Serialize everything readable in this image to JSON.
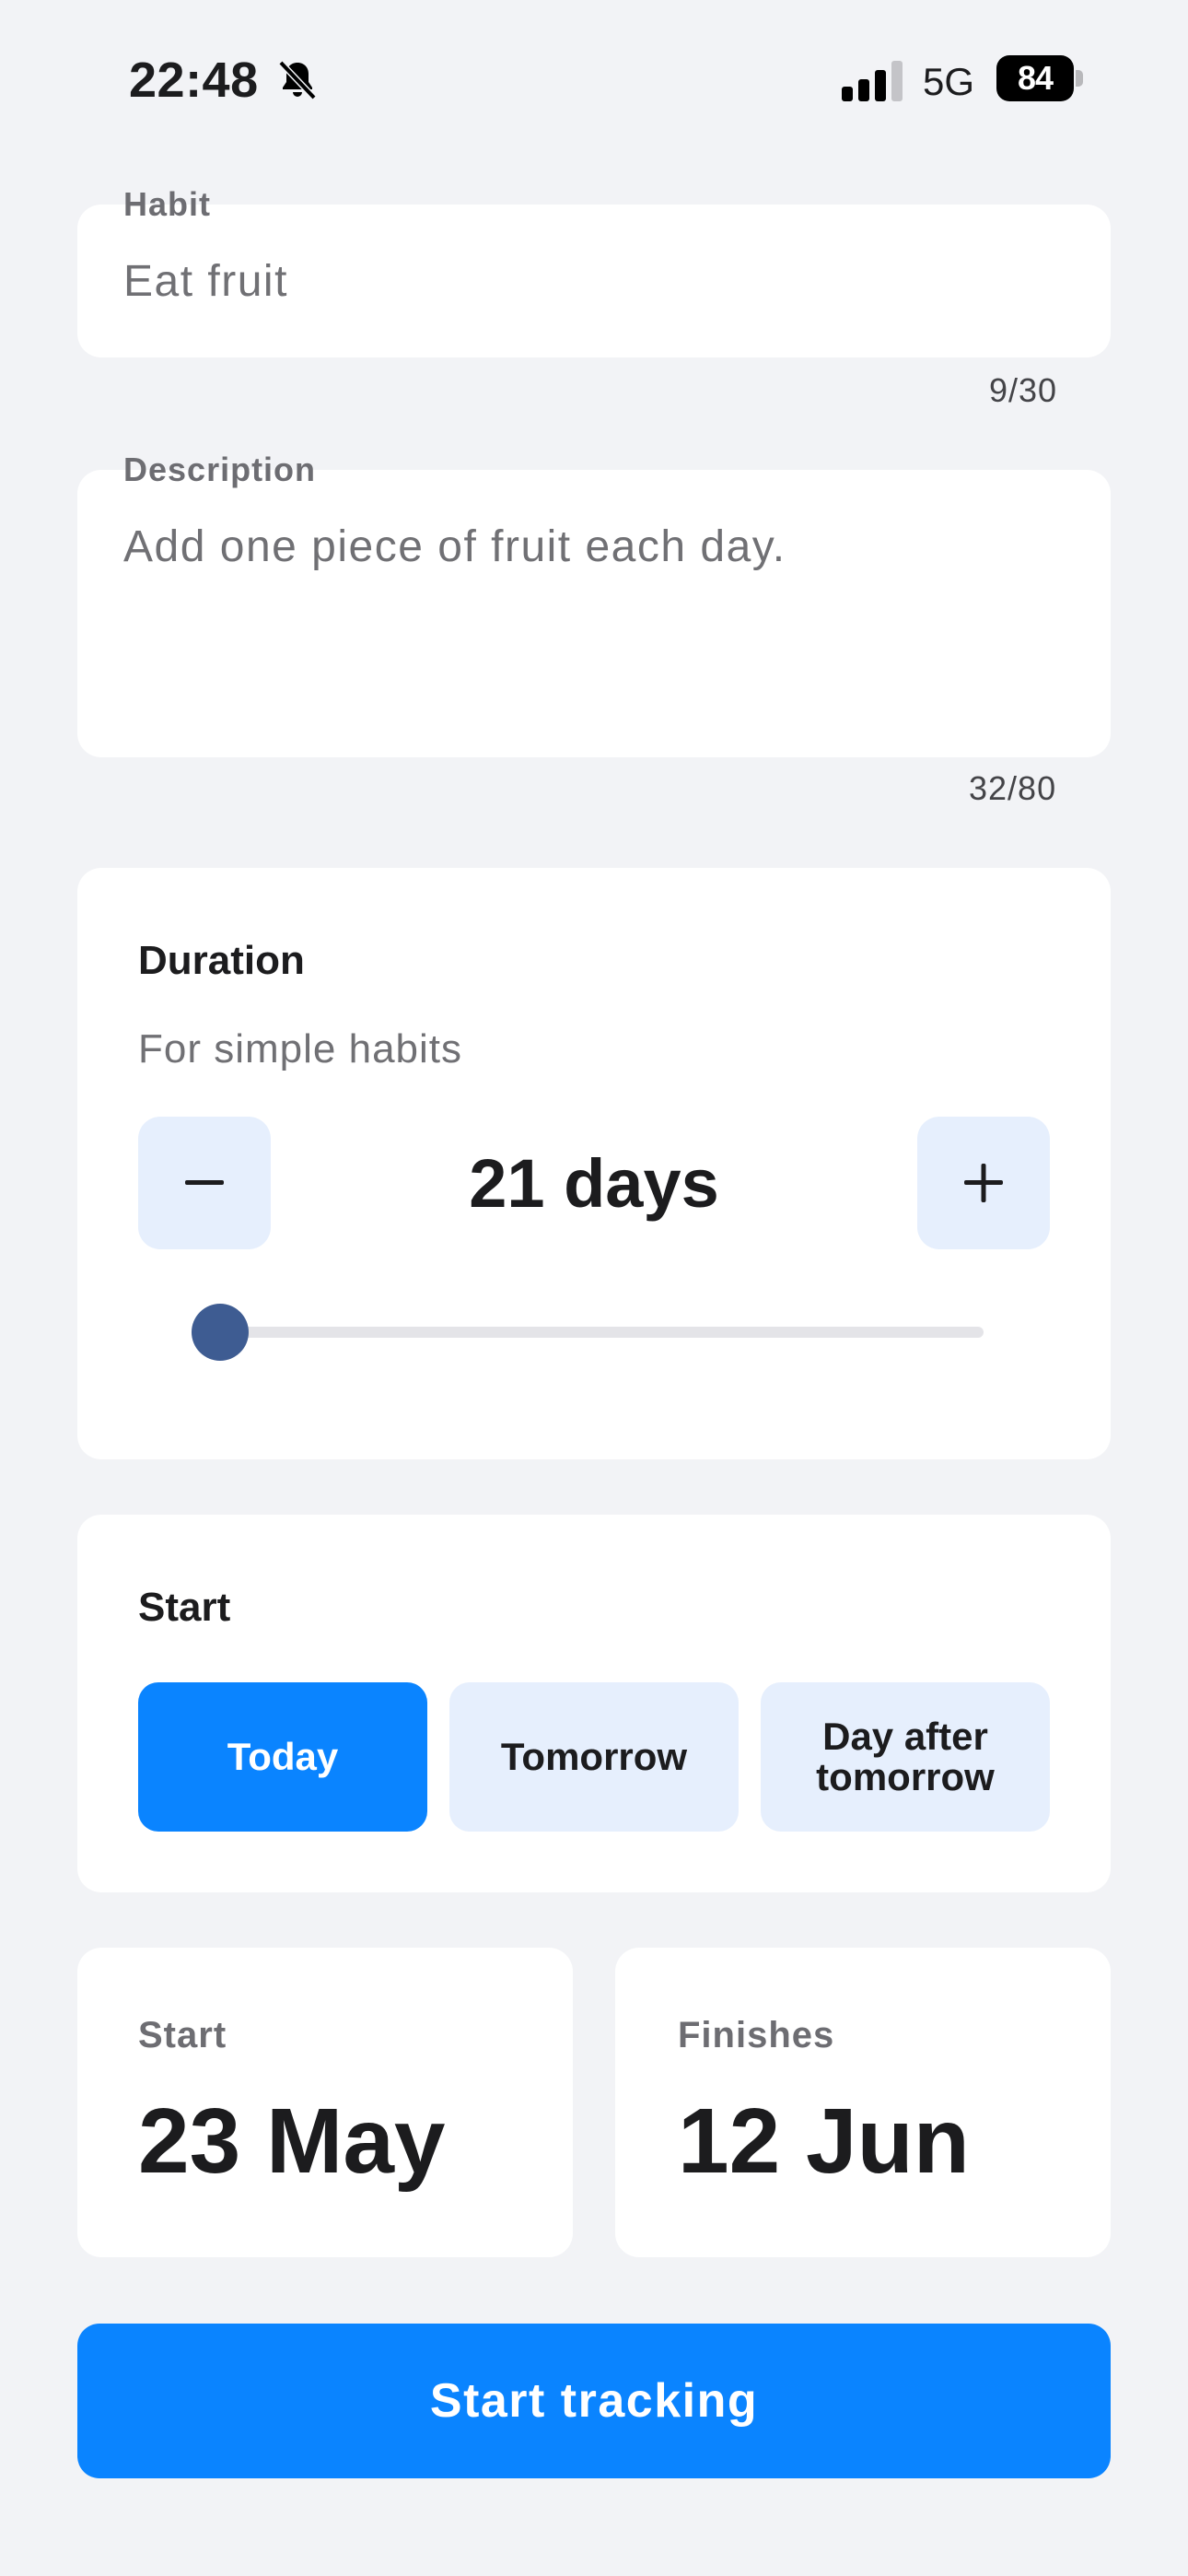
{
  "status_bar": {
    "time": "22:48",
    "network": "5G",
    "battery": "84",
    "icons": [
      "bell-slash-icon",
      "cellular-signal-icon",
      "battery-icon"
    ]
  },
  "habit": {
    "label": "Habit",
    "value": "Eat fruit",
    "counter": "9/30"
  },
  "description": {
    "label": "Description",
    "value": "Add one piece of fruit each day.",
    "counter": "32/80"
  },
  "duration": {
    "title": "Duration",
    "subtitle": "For simple habits",
    "value": "21 days",
    "slider_fraction": 0.0,
    "icons": [
      "minus-icon",
      "plus-icon"
    ]
  },
  "start_options": {
    "title": "Start",
    "options": [
      "Today",
      "Tomorrow",
      "Day after tomorrow"
    ],
    "selected": "Today"
  },
  "dates": {
    "start_label": "Start",
    "start_value": "23 May",
    "finish_label": "Finishes",
    "finish_value": "12 Jun"
  },
  "action": {
    "label": "Start tracking"
  },
  "colors": {
    "accent": "#0a84ff",
    "stepper_bg": "#e6effd",
    "slider_thumb": "#3e5c92",
    "background": "#f2f3f6"
  }
}
